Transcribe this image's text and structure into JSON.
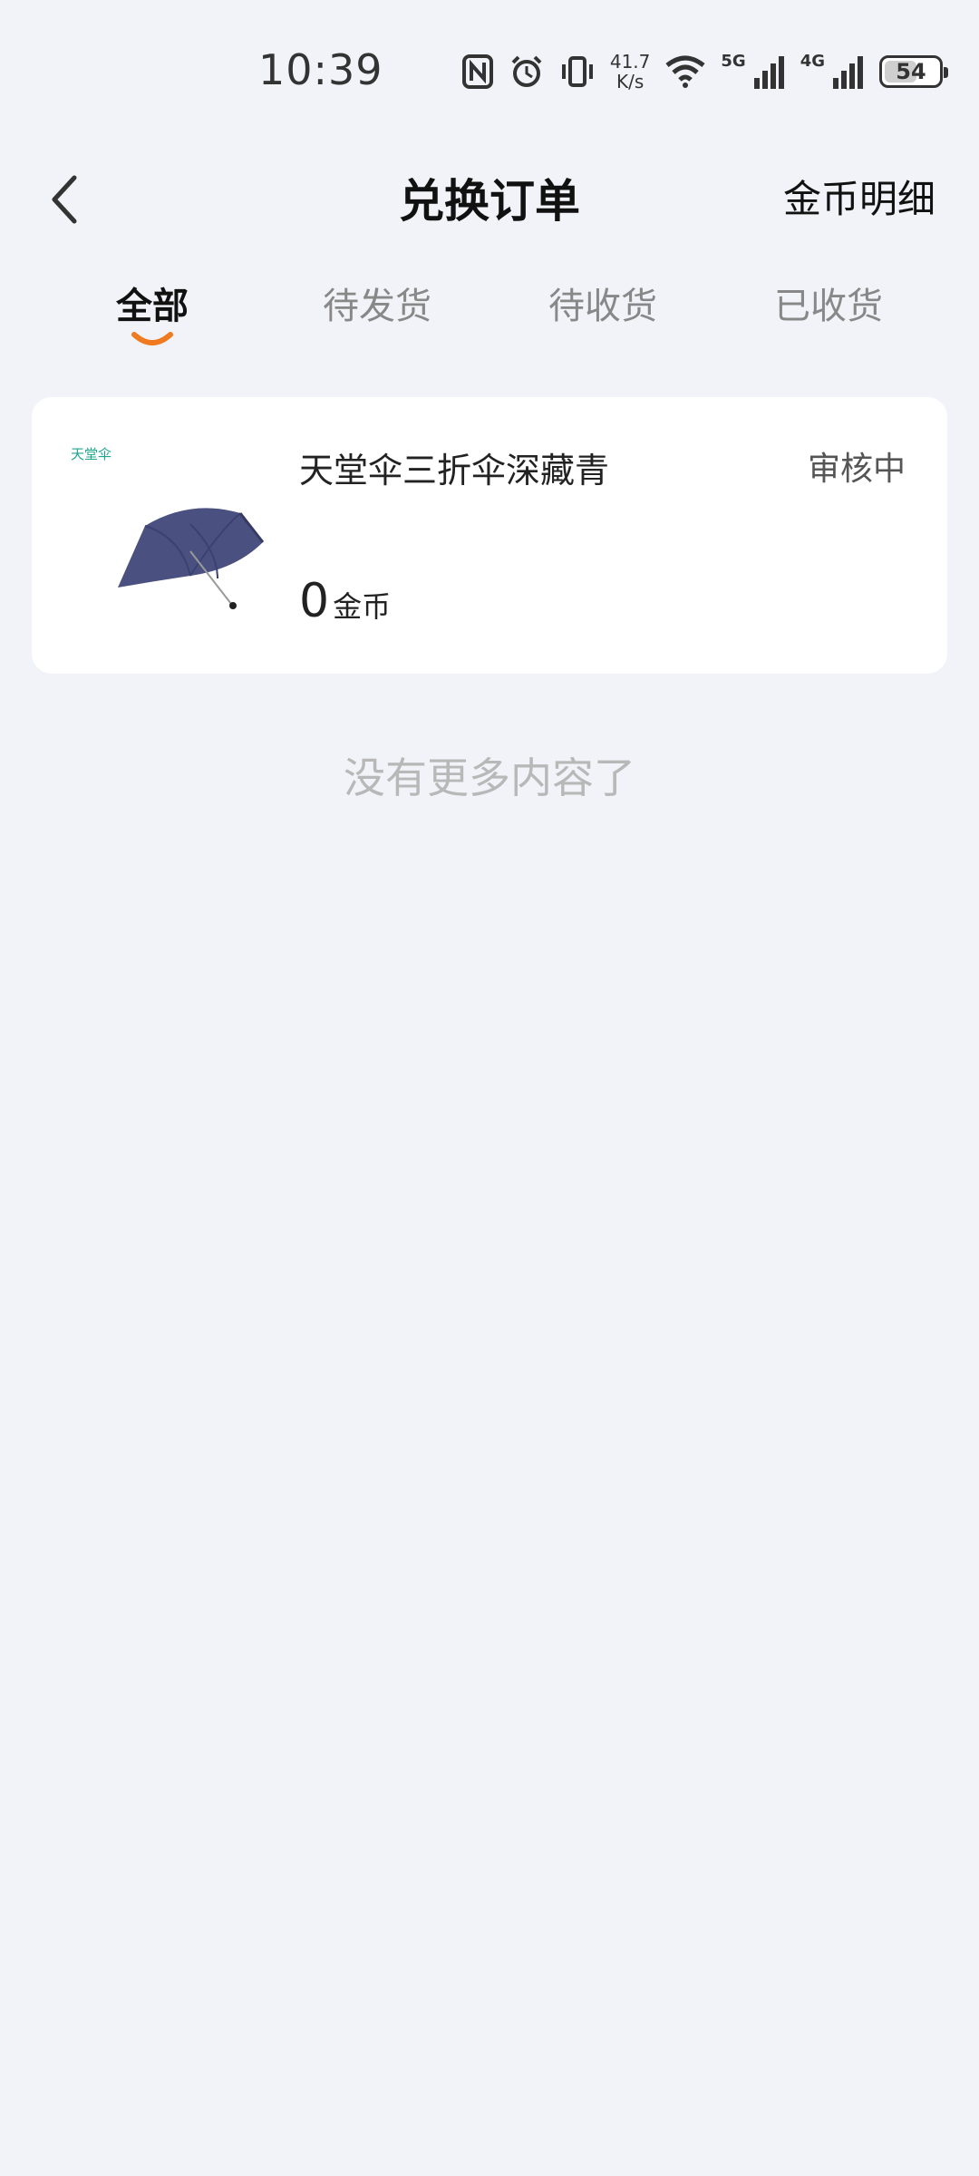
{
  "status_bar": {
    "time": "10:39",
    "net_speed_value": "41.7",
    "net_speed_unit": "K/s",
    "signal_5g": "5G",
    "signal_4g": "4G",
    "battery": "54"
  },
  "header": {
    "title": "兑换订单",
    "right_link": "金币明细"
  },
  "tabs": [
    {
      "label": "全部",
      "active": true
    },
    {
      "label": "待发货",
      "active": false
    },
    {
      "label": "待收货",
      "active": false
    },
    {
      "label": "已收货",
      "active": false
    }
  ],
  "colors": {
    "accent": "#f07a1f",
    "background": "#f2f3f8",
    "umbrella": "#4a5180",
    "brand": "#1fa58e"
  },
  "orders": [
    {
      "brand": "天堂伞",
      "name": "天堂伞三折伞深藏青",
      "status": "审核中",
      "price": "0",
      "unit": "金币"
    }
  ],
  "footer_text": "没有更多内容了"
}
